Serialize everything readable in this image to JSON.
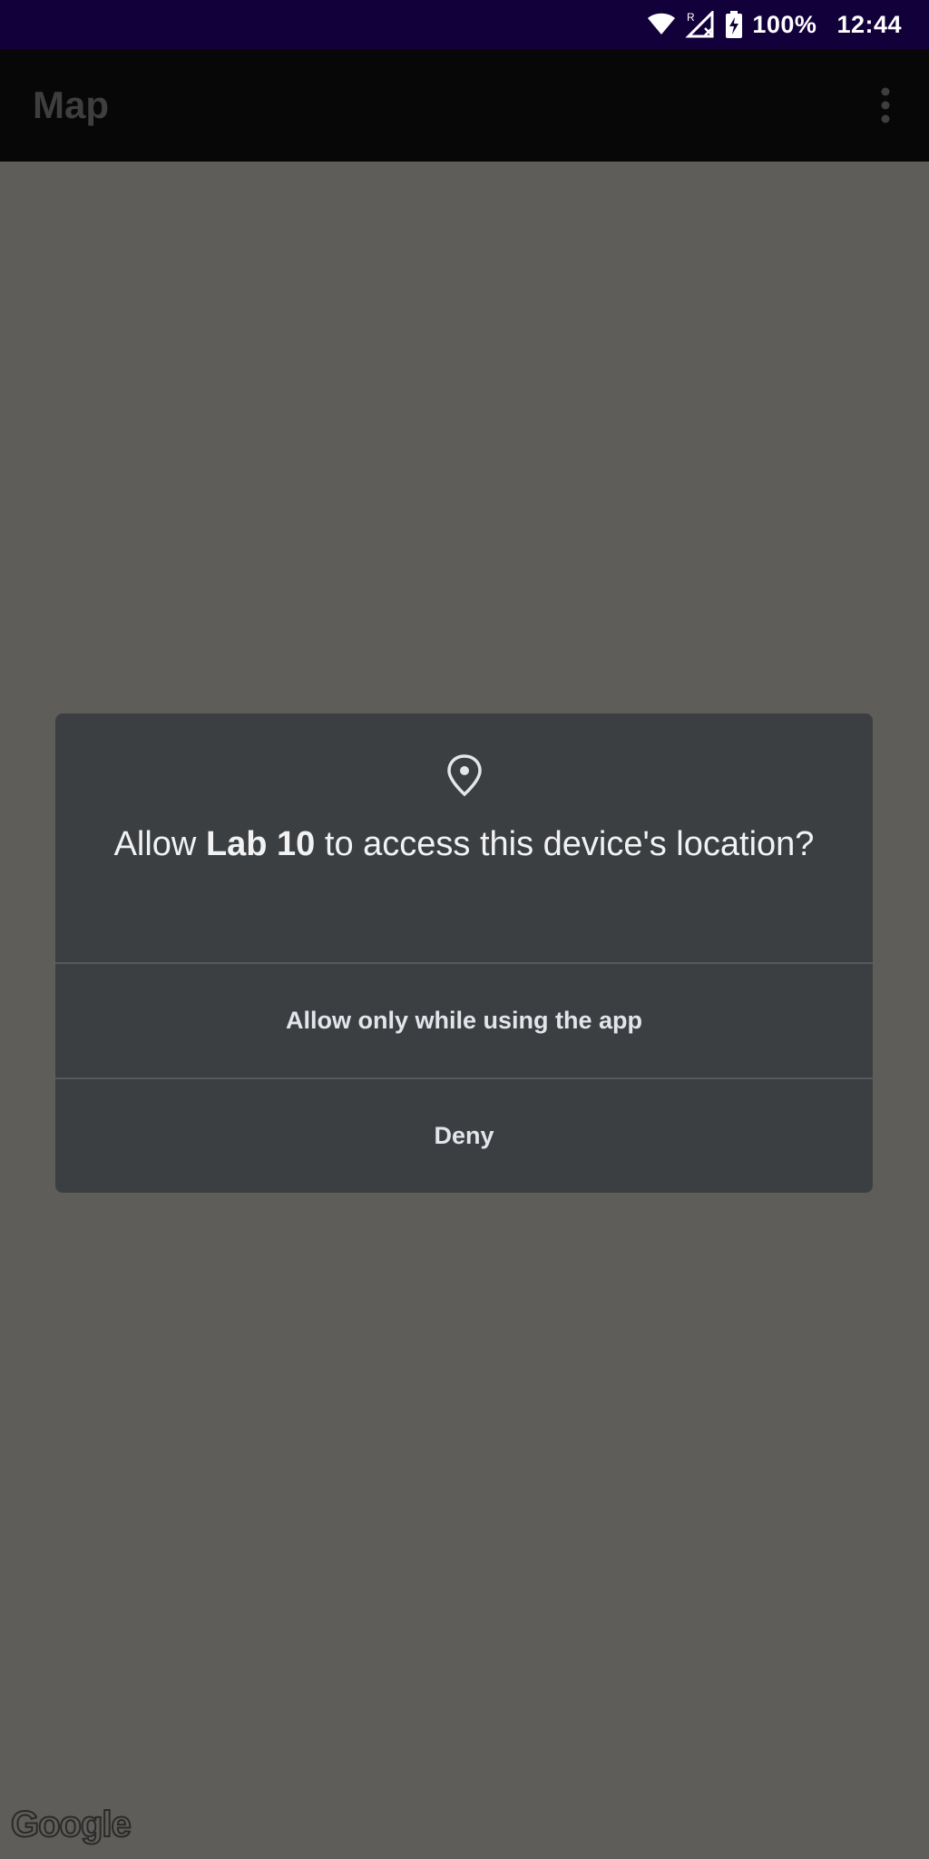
{
  "status_bar": {
    "battery_text": "100%",
    "time": "12:44",
    "wifi_icon": "wifi-icon",
    "signal_icon": "signal-no-service-icon",
    "roaming_indicator": "R",
    "battery_icon": "battery-charging-icon"
  },
  "app_bar": {
    "title": "Map",
    "overflow_icon": "more-vert-icon"
  },
  "dialog": {
    "icon": "location-pin-icon",
    "title_prefix": "Allow ",
    "app_name": "Lab 10",
    "title_suffix": " to access this device's location?",
    "buttons": [
      {
        "label": "Allow only while using the app"
      },
      {
        "label": "Deny"
      }
    ]
  },
  "map": {
    "attribution": "Google"
  },
  "colors": {
    "status_bar": "#12003a",
    "app_bar": "#070707",
    "scrim": "#5e5d59",
    "dialog": "#3c3f42",
    "divider": "#55585c"
  }
}
